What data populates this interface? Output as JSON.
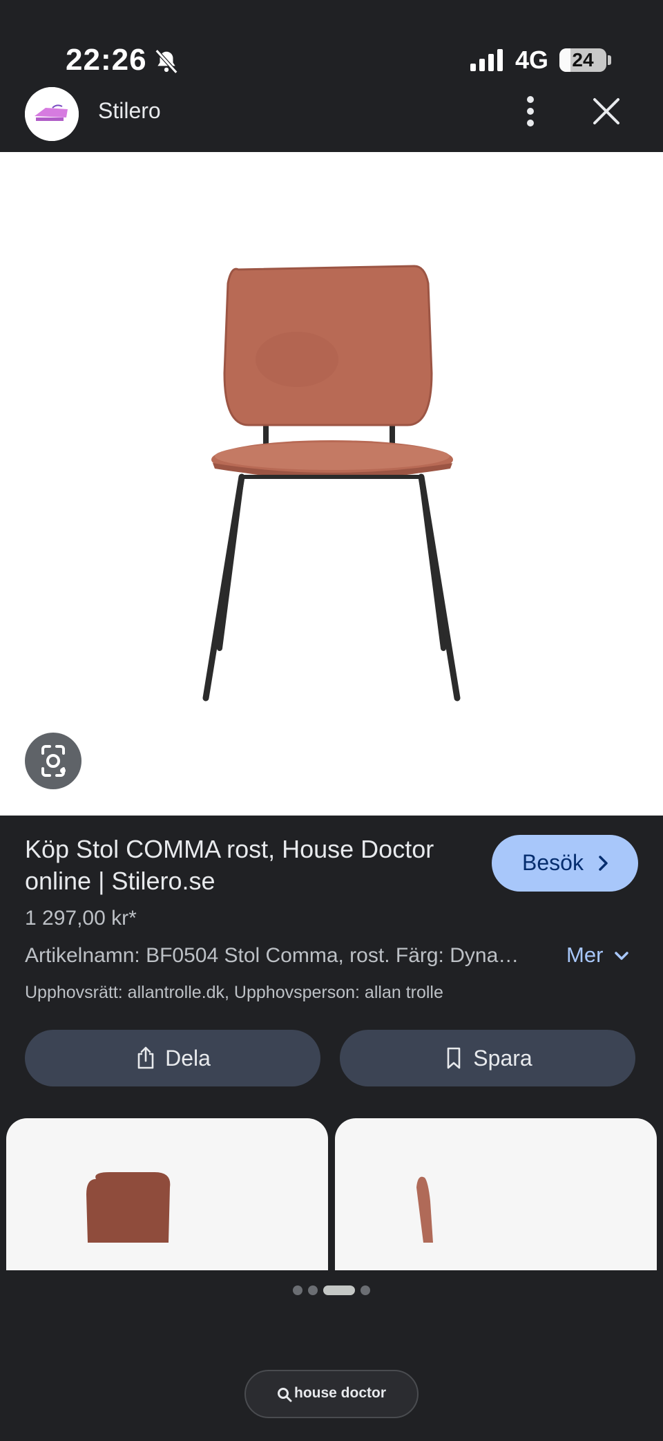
{
  "status_bar": {
    "time": "22:26",
    "network": "4G",
    "battery": "24",
    "battery_level": 0.24,
    "icons": [
      "bell-slash-icon",
      "signal-icon",
      "battery-icon"
    ]
  },
  "header": {
    "site_name": "Stilero",
    "icons": [
      "avatar",
      "more-vert-icon",
      "close-icon"
    ]
  },
  "image": {
    "lens_icon": "lens-icon",
    "colors": {
      "upholstery": "#b86a55",
      "frame": "#2b2b2b",
      "background": "#ffffff"
    }
  },
  "result": {
    "title": "Köp Stol COMMA rost, House Doctor online | Stilero.se",
    "visit_label": "Besök",
    "price": "1 297,00 kr*",
    "description": "Artikelnamn: BF0504 Stol Comma, rost. Färg: Dyna…",
    "more_label": "Mer",
    "copyright": "Upphovsrätt: allantrolle.dk, Upphovsperson: allan trolle"
  },
  "actions": {
    "share_label": "Dela",
    "save_label": "Spara"
  },
  "pagination": {
    "count": 4,
    "active_index": 2
  },
  "search": {
    "query": "house doctor"
  },
  "colors": {
    "background": "#202124",
    "accent": "#a8c7fa",
    "button": "#3c4454"
  }
}
